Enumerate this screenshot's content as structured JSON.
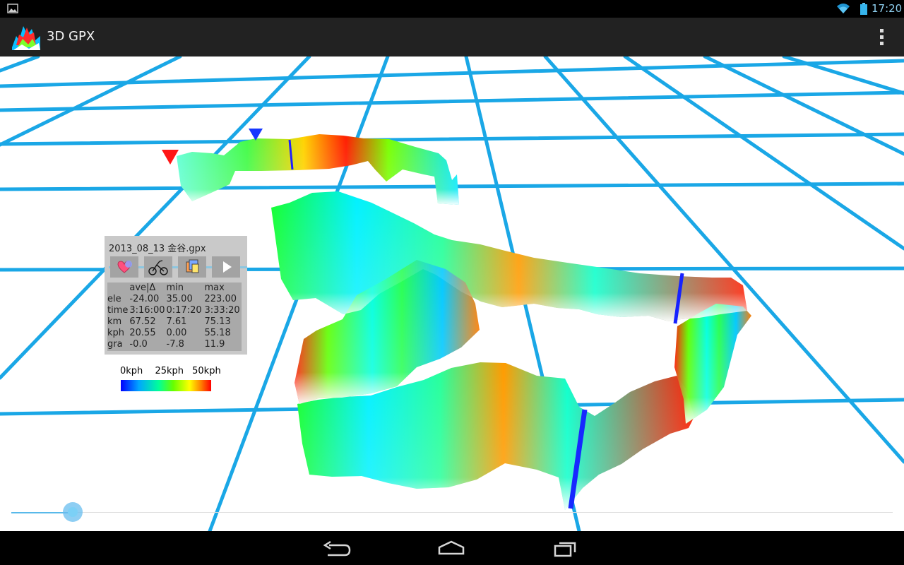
{
  "status_bar": {
    "time": "17:20",
    "colors": {
      "icon": "#8fd0f0",
      "background": "#000000"
    }
  },
  "app": {
    "title": "3D GPX"
  },
  "scene": {
    "grid_color": "#1aa7e6",
    "description_kind": "3d-gpx-speed-profile"
  },
  "info_panel": {
    "file_name": "2013_08_13 金谷.gpx",
    "toolbar_icons": [
      "heart-icon",
      "bike-icon",
      "layers-icon",
      "play-icon"
    ],
    "stats": {
      "headers": [
        "",
        "ave|Δ",
        "min",
        "max"
      ],
      "rows": [
        [
          "ele",
          "-24.00",
          "35.00",
          "223.00"
        ],
        [
          "time",
          "3:16:00",
          "0:17:20",
          "3:33:20"
        ],
        [
          "km",
          "67.52",
          "7.61",
          "75.13"
        ],
        [
          "kph",
          "20.55",
          "0.00",
          "55.18"
        ],
        [
          "gra",
          "-0.0",
          "-7.8",
          "11.9"
        ]
      ]
    }
  },
  "legend": {
    "labels": [
      "0kph",
      "25kph",
      "50kph"
    ]
  },
  "seekbar": {
    "progress": 0.07
  },
  "nav": {
    "icons": [
      "back-icon",
      "home-icon",
      "recents-icon"
    ]
  }
}
